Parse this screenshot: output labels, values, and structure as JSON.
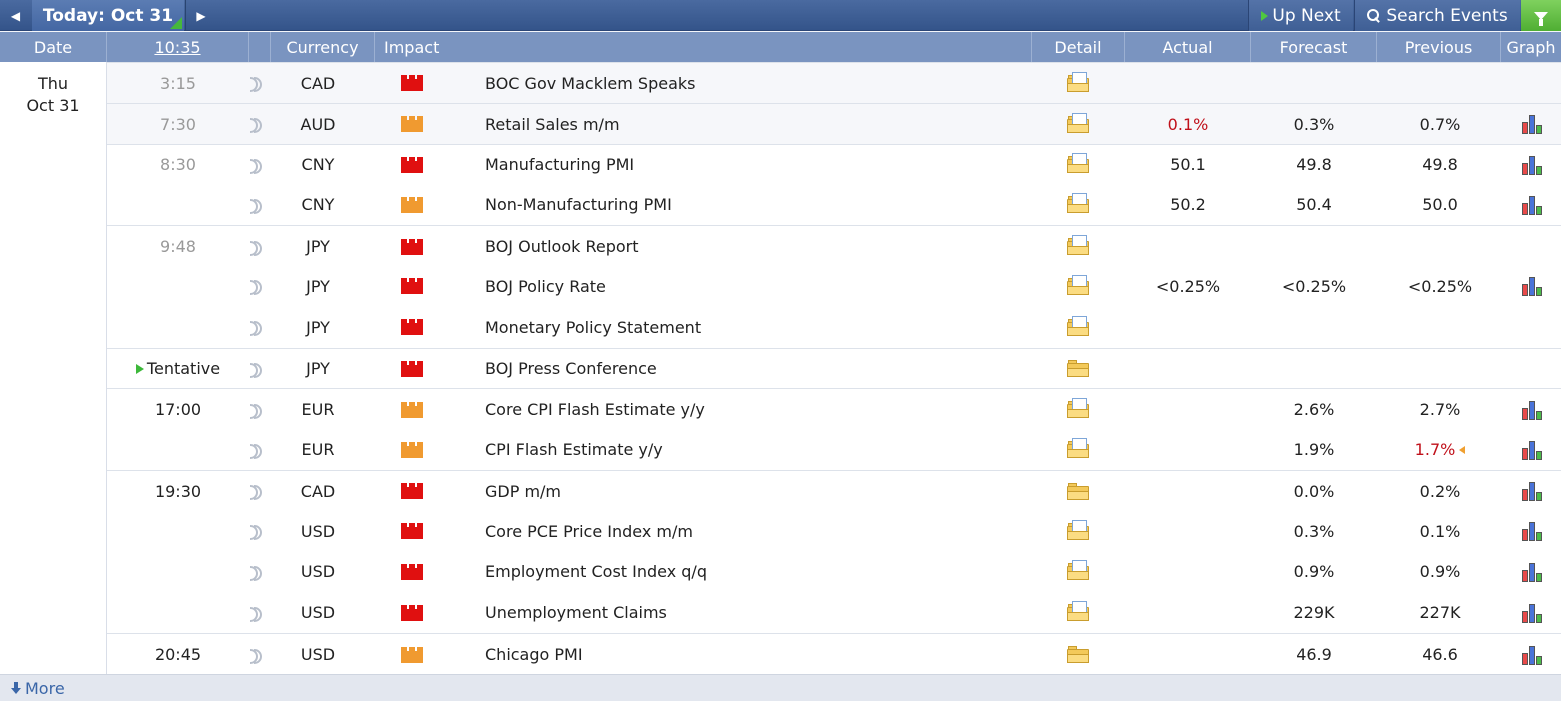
{
  "nav": {
    "today_label": "Today: Oct 31",
    "up_next_label": "Up Next",
    "search_label": "Search Events"
  },
  "columns": {
    "date": "Date",
    "clock": "10:35",
    "currency": "Currency",
    "impact": "Impact",
    "detail": "Detail",
    "actual": "Actual",
    "forecast": "Forecast",
    "previous": "Previous",
    "graph": "Graph"
  },
  "day": {
    "weekday": "Thu",
    "date": "Oct 31"
  },
  "colors": {
    "impact_high": "#e01010",
    "impact_medium": "#f09a30",
    "better_worse": "#c0101a"
  },
  "events": [
    {
      "time": "3:15",
      "currency": "CAD",
      "impact": "high",
      "event": "BOC Gov Macklem Speaks",
      "actual": "",
      "forecast": "",
      "previous": "",
      "graph": false,
      "detail": "folder-doc-icon"
    },
    {
      "time": "7:30",
      "currency": "AUD",
      "impact": "medium",
      "event": "Retail Sales m/m",
      "actual": "0.1%",
      "actual_red": true,
      "forecast": "0.3%",
      "previous": "0.7%",
      "graph": true,
      "detail": "folder-doc-icon"
    },
    {
      "time": "8:30",
      "currency": "CNY",
      "impact": "high",
      "event": "Manufacturing PMI",
      "actual": "50.1",
      "forecast": "49.8",
      "previous": "49.8",
      "graph": true,
      "detail": "folder-doc-icon"
    },
    {
      "time": "",
      "currency": "CNY",
      "impact": "medium",
      "event": "Non-Manufacturing PMI",
      "actual": "50.2",
      "forecast": "50.4",
      "previous": "50.0",
      "graph": true,
      "detail": "folder-doc-icon"
    },
    {
      "time": "9:48",
      "currency": "JPY",
      "impact": "high",
      "event": "BOJ Outlook Report",
      "actual": "",
      "forecast": "",
      "previous": "",
      "graph": false,
      "detail": "folder-doc-icon"
    },
    {
      "time": "",
      "currency": "JPY",
      "impact": "high",
      "event": "BOJ Policy Rate",
      "actual": "<0.25%",
      "forecast": "<0.25%",
      "previous": "<0.25%",
      "graph": true,
      "detail": "folder-doc-icon"
    },
    {
      "time": "",
      "currency": "JPY",
      "impact": "high",
      "event": "Monetary Policy Statement",
      "actual": "",
      "forecast": "",
      "previous": "",
      "graph": false,
      "detail": "folder-doc-icon"
    },
    {
      "time": "Tentative",
      "currency": "JPY",
      "impact": "high",
      "event": "BOJ Press Conference",
      "actual": "",
      "forecast": "",
      "previous": "",
      "graph": false,
      "detail": "folder-icon"
    },
    {
      "time": "17:00",
      "currency": "EUR",
      "impact": "medium",
      "event": "Core CPI Flash Estimate y/y",
      "actual": "",
      "forecast": "2.6%",
      "previous": "2.7%",
      "graph": true,
      "detail": "folder-doc-icon"
    },
    {
      "time": "",
      "currency": "EUR",
      "impact": "medium",
      "event": "CPI Flash Estimate y/y",
      "actual": "",
      "forecast": "1.9%",
      "previous": "1.7%",
      "previous_red": true,
      "graph": true,
      "detail": "folder-doc-icon"
    },
    {
      "time": "19:30",
      "currency": "CAD",
      "impact": "high",
      "event": "GDP m/m",
      "actual": "",
      "forecast": "0.0%",
      "previous": "0.2%",
      "graph": true,
      "detail": "folder-icon"
    },
    {
      "time": "",
      "currency": "USD",
      "impact": "high",
      "event": "Core PCE Price Index m/m",
      "actual": "",
      "forecast": "0.3%",
      "previous": "0.1%",
      "graph": true,
      "detail": "folder-doc-icon"
    },
    {
      "time": "",
      "currency": "USD",
      "impact": "high",
      "event": "Employment Cost Index q/q",
      "actual": "",
      "forecast": "0.9%",
      "previous": "0.9%",
      "graph": true,
      "detail": "folder-doc-icon"
    },
    {
      "time": "",
      "currency": "USD",
      "impact": "high",
      "event": "Unemployment Claims",
      "actual": "",
      "forecast": "229K",
      "previous": "227K",
      "graph": true,
      "detail": "folder-doc-icon"
    },
    {
      "time": "20:45",
      "currency": "USD",
      "impact": "medium",
      "event": "Chicago PMI",
      "actual": "",
      "forecast": "46.9",
      "previous": "46.6",
      "graph": true,
      "detail": "folder-icon"
    }
  ],
  "footer": {
    "more_label": "More"
  }
}
